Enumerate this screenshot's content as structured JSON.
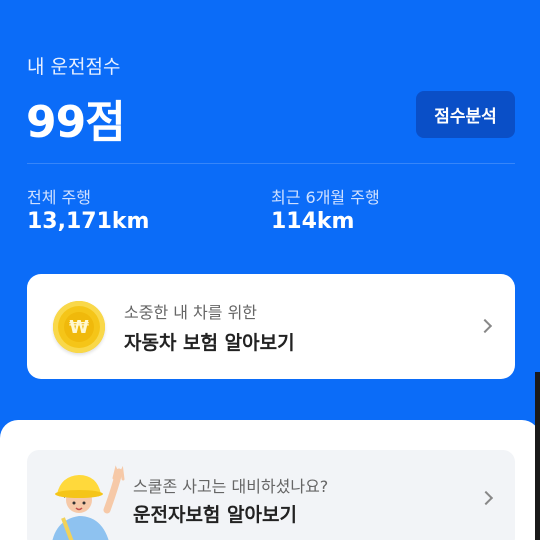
{
  "score": {
    "label": "내 운전점수",
    "value": "99점",
    "analyze_button": "점수분석"
  },
  "stats": {
    "total_label": "전체 주행",
    "total_value": "13,171km",
    "recent_label": "최근 6개월 주행",
    "recent_value": "114km"
  },
  "insurance_card": {
    "subtitle": "소중한 내 차를 위한",
    "title": "자동차 보험 알아보기",
    "coin_symbol": "₩"
  },
  "driver_card": {
    "subtitle": "스쿨존 사고는 대비하셨나요?",
    "title": "운전자보험 알아보기"
  },
  "colors": {
    "primary": "#0b6cf8",
    "button": "#0a4fc7",
    "coin": "#f5c518"
  },
  "icons": [
    "won-coin-icon",
    "chevron-right-icon",
    "waving-person-illustration"
  ]
}
